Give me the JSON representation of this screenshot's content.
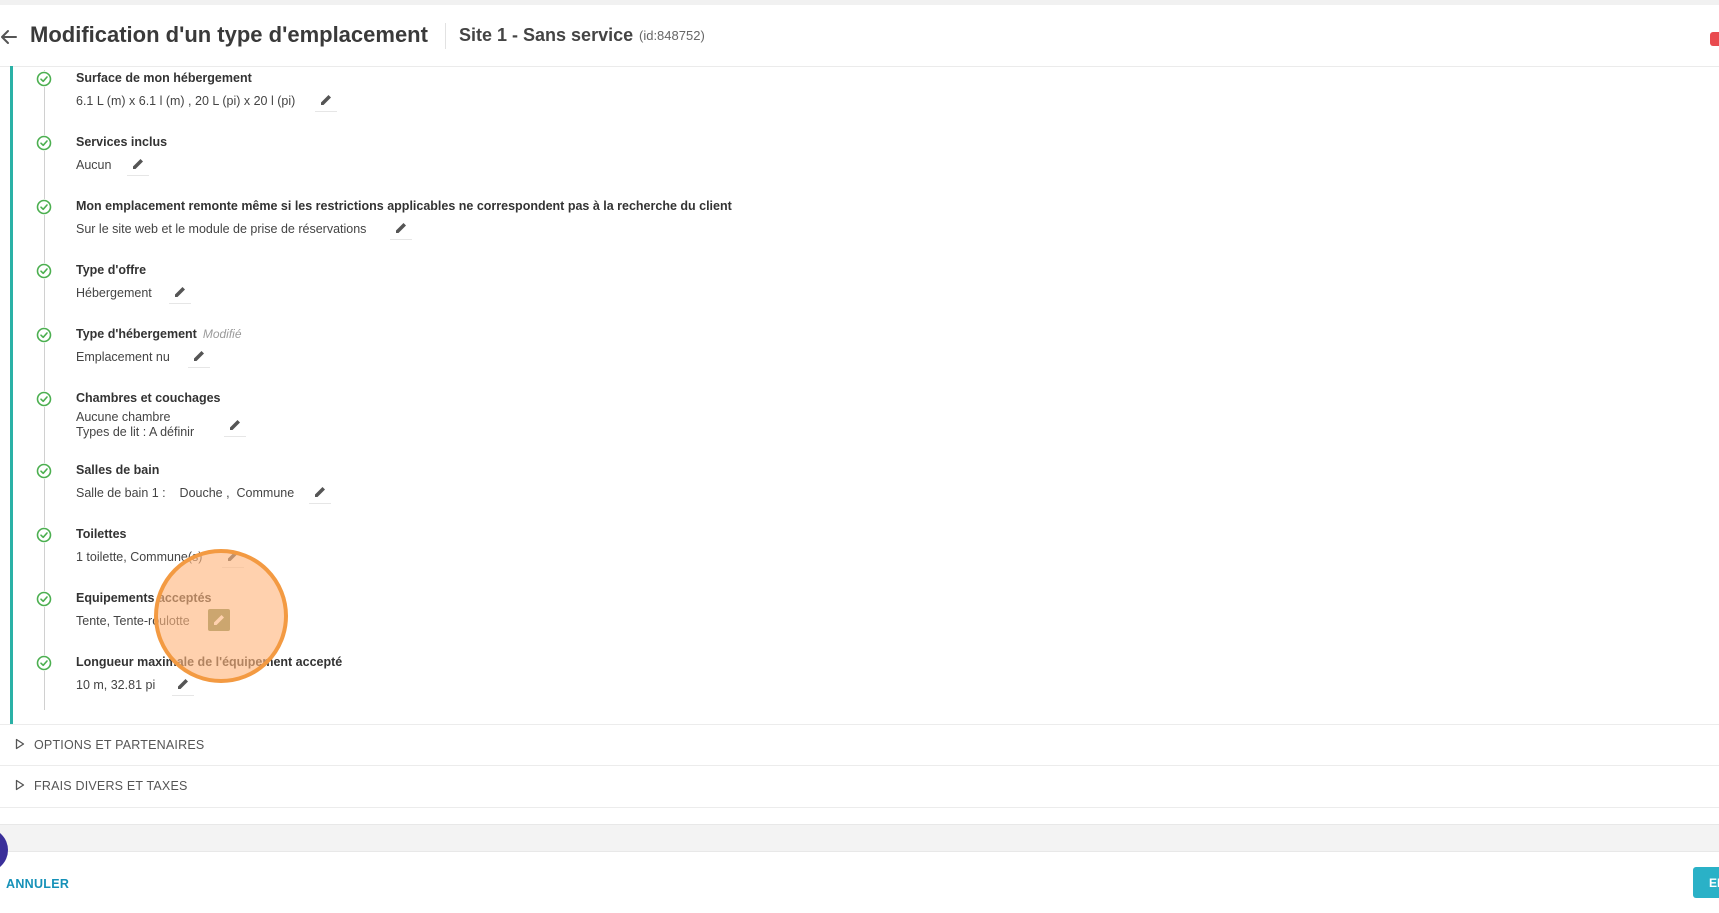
{
  "header": {
    "title": "Modification d'un type d'emplacement",
    "site_name": "Site 1 - Sans service",
    "site_id": "(id:848752)"
  },
  "steps": [
    {
      "title": "Surface de mon hébergement",
      "modified": "",
      "value": "6.1 L (m) x 6.1 l (m) , 20 L (pi) x 20 l (pi)",
      "value2": ""
    },
    {
      "title": "Services inclus",
      "modified": "",
      "value": "Aucun",
      "value2": ""
    },
    {
      "title": "Mon emplacement remonte même si les restrictions applicables ne correspondent pas à la recherche du client",
      "modified": "",
      "value": "Sur le site web et le module de prise de réservations",
      "value2": ""
    },
    {
      "title": "Type d'offre",
      "modified": "",
      "value": "Hébergement",
      "value2": ""
    },
    {
      "title": "Type d'hébergement",
      "modified": "Modifié",
      "value": "Emplacement nu",
      "value2": ""
    },
    {
      "title": "Chambres et couchages",
      "modified": "",
      "value": "Aucune chambre",
      "value2": "Types de lit :    A définir"
    },
    {
      "title": "Salles de bain",
      "modified": "",
      "value": "Salle de bain 1 :    Douche ,  Commune",
      "value2": ""
    },
    {
      "title": "Toilettes",
      "modified": "",
      "value": "1 toilette, Commune(s)",
      "value2": ""
    },
    {
      "title": "Equipements acceptés",
      "modified": "",
      "value": "Tente, Tente-roulotte",
      "value2": ""
    },
    {
      "title": "Longueur maximale de l'équipement accepté",
      "modified": "",
      "value": "10 m, 32.81 pi",
      "value2": ""
    }
  ],
  "sections": [
    {
      "label": "OPTIONS ET PARTENAIRES"
    },
    {
      "label": "FRAIS DIVERS ET TAXES"
    }
  ],
  "footer": {
    "cancel_label": "ANNULER",
    "save_label": "EN"
  },
  "colors": {
    "accent": "#2ab1a6",
    "check": "#4caf50",
    "link": "#1591b8",
    "highlight": "#f39a42"
  },
  "icons": [
    "arrow-left-icon",
    "check-circle-icon",
    "pencil-icon",
    "triangle-right-icon"
  ]
}
